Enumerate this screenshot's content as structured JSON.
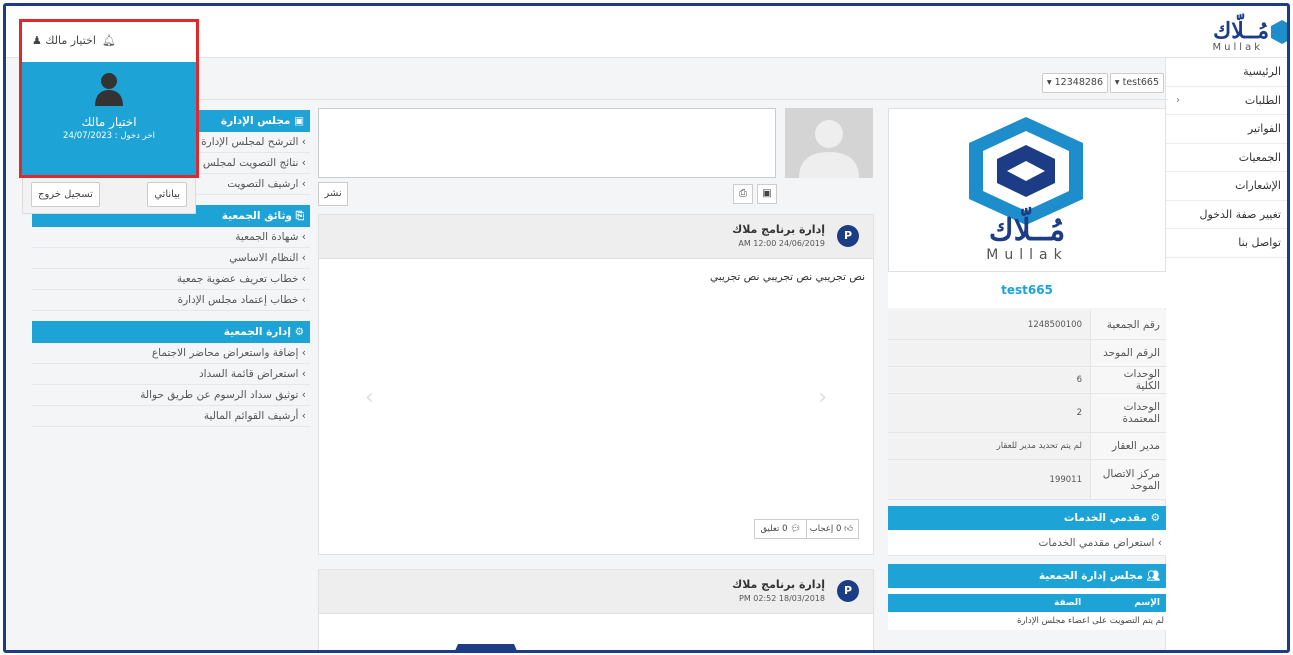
{
  "topbar": {
    "logo_ar": "مُــلّاك",
    "logo_en": "Mullak",
    "user_name": "اختيار مالك"
  },
  "sidebar": {
    "items": [
      {
        "label": "الرئيسية"
      },
      {
        "label": "الطلبات",
        "has_arrow": true
      },
      {
        "label": "الفواتير"
      },
      {
        "label": "الجمعيات"
      },
      {
        "label": "الإشعارات"
      },
      {
        "label": "تغيير صفة الدخول"
      },
      {
        "label": "تواصل بنا"
      }
    ]
  },
  "filters": {
    "association": "test665",
    "unit": "12348286"
  },
  "user_panel": {
    "name": "اختيار مالك",
    "last_login": "اخر دخول : 24/07/2023",
    "my_data_button": "بياناتي",
    "logout_button": "تسجيل خروج"
  },
  "left": {
    "board_section": {
      "title": "مجلس الإدارة",
      "items": [
        "الترشح لمجلس الإدارة",
        "نتائج التصويت لمجلس الإدارة",
        "ارشيف التصويت"
      ]
    },
    "docs_section": {
      "title": "وثائق الجمعية",
      "items": [
        "شهادة الجمعية",
        "النظام الاساسي",
        "خطاب تعريف عضوية جمعية",
        "خطاب إعتماد مجلس الإدارة"
      ]
    },
    "mgmt_section": {
      "title": "إدارة الجمعية",
      "items": [
        "إضافة واستعراض محاضر الاجتماع",
        "استعراض قائمة السداد",
        "توثيق سداد الرسوم عن طريق حوالة",
        "أرشيف القوائم المالية"
      ]
    }
  },
  "composer": {
    "publish_button": "نشر"
  },
  "posts": [
    {
      "author": "إدارة برنامج ملاك",
      "date": "AM 12:00 24/06/2019",
      "body": "نص تجريبي نص تجريبي نص تجريبي",
      "like_label": "0 إعجاب",
      "comment_label": "0 تعليق"
    },
    {
      "author": "إدارة برنامج ملاك",
      "date": "PM 02:52 18/03/2018"
    }
  ],
  "profile": {
    "association_name": "test665",
    "logo_ar": "مُــلّاك",
    "logo_en": "Mullak",
    "rows": [
      {
        "label": "رقم الجمعية",
        "value": "1248500100"
      },
      {
        "label": "الرقم الموحد",
        "value": ""
      },
      {
        "label": "الوحدات الكلية",
        "value": "6"
      },
      {
        "label": "الوحدات المعتمدة",
        "value": "2"
      },
      {
        "label": "مدير العقار",
        "value": "لم يتم تحديد مدير للعقار"
      },
      {
        "label": "مركز الاتصال الموحد",
        "value": "199011"
      }
    ],
    "providers_title": "مقدمي الخدمات",
    "providers_link": "استعراض مقدمي الخدمات",
    "board_title": "مجلس إدارة الجمعية",
    "board_col_name": "الإسم",
    "board_col_role": "الصفة",
    "board_empty": "لم يتم التصويت على اعضاء مجلس الإدارة"
  },
  "colors": {
    "brand": "#1d3c86",
    "accent": "#1ea3d6",
    "highlight": "#e0282e"
  }
}
